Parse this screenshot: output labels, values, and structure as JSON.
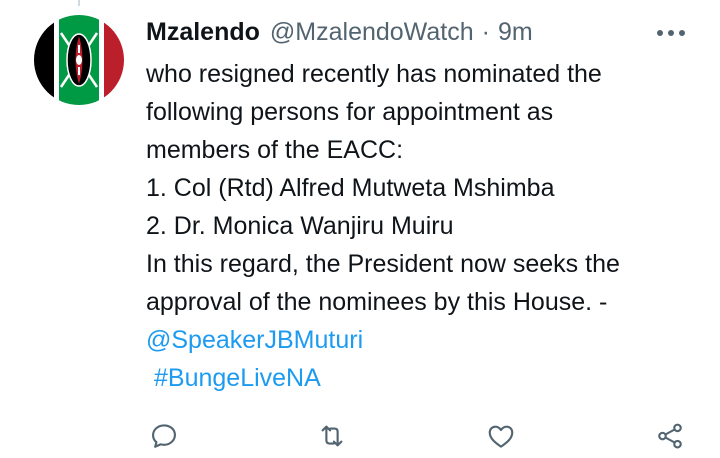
{
  "tweet": {
    "author_name": "Mzalendo",
    "author_handle": "@MzalendoWatch",
    "separator": "·",
    "timestamp": "9m",
    "body_lines": [
      "who resigned recently has nominated the",
      "following persons for appointment as",
      "members of the EACC:",
      "1. Col (Rtd) Alfred Mutweta Mshimba",
      "2. Dr. Monica Wanjiru Muiru",
      "In this regard, the President now seeks the",
      "approval of the nominees by this House. -"
    ],
    "mention": "@SpeakerJBMuturi",
    "hashtag": "#BungeLiveNA"
  },
  "actions": [
    "reply-icon",
    "retweet-icon",
    "like-icon",
    "share-icon"
  ],
  "colors": {
    "text": "#0f1419",
    "secondary": "#536471",
    "link": "#1d9bf0",
    "icon": "#536471"
  }
}
